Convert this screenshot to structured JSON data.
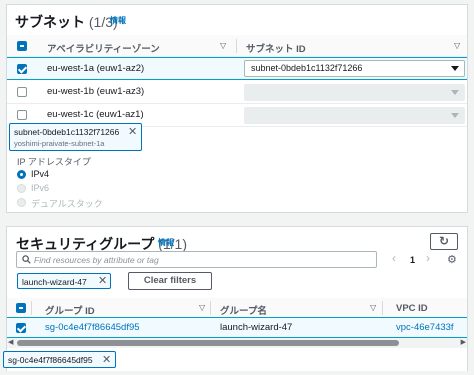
{
  "subnet_section": {
    "title": "サブネット",
    "count": "(1/3)",
    "info": "情報",
    "columns": [
      "アベイラビリティーゾーン",
      "サブネット ID"
    ],
    "rows": [
      {
        "az": "eu-west-1a (euw1-az2)",
        "subnet_value": "subnet-0bdeb1c1132f71266",
        "selected": true
      },
      {
        "az": "eu-west-1b (euw1-az3)",
        "subnet_value": "",
        "selected": false
      },
      {
        "az": "eu-west-1c (euw1-az1)",
        "subnet_value": "",
        "selected": false
      }
    ],
    "token": {
      "id": "subnet-0bdeb1c1132f71266",
      "name": "yoshimi-praivate-subnet-1a"
    },
    "ip_type_label": "IP アドレスタイプ",
    "ip_options": [
      {
        "label": "IPv4",
        "selected": true
      },
      {
        "label": "IPv6",
        "selected": false
      },
      {
        "label": "デュアルスタック",
        "selected": false
      }
    ]
  },
  "sg_section": {
    "title": "セキュリティグループ",
    "count": "(1/1)",
    "info": "情報",
    "refresh_icon": "refresh-icon",
    "search_placeholder": "Find resources by attribute or tag",
    "page": "1",
    "filter_token": "launch-wizard-47",
    "clear_filters": "Clear filters",
    "columns": [
      "グループ ID",
      "グループ名",
      "VPC ID"
    ],
    "rows": [
      {
        "group_id": "sg-0c4e4f7f86645df95",
        "group_name": "launch-wizard-47",
        "vpc_id": "vpc-46e7433f",
        "selected": true
      }
    ],
    "selected_token": "sg-0c4e4f7f86645df95"
  },
  "colors": {
    "accent": "#0073bb",
    "selected_bg": "#f1faff",
    "border": "#d5dbdb"
  }
}
